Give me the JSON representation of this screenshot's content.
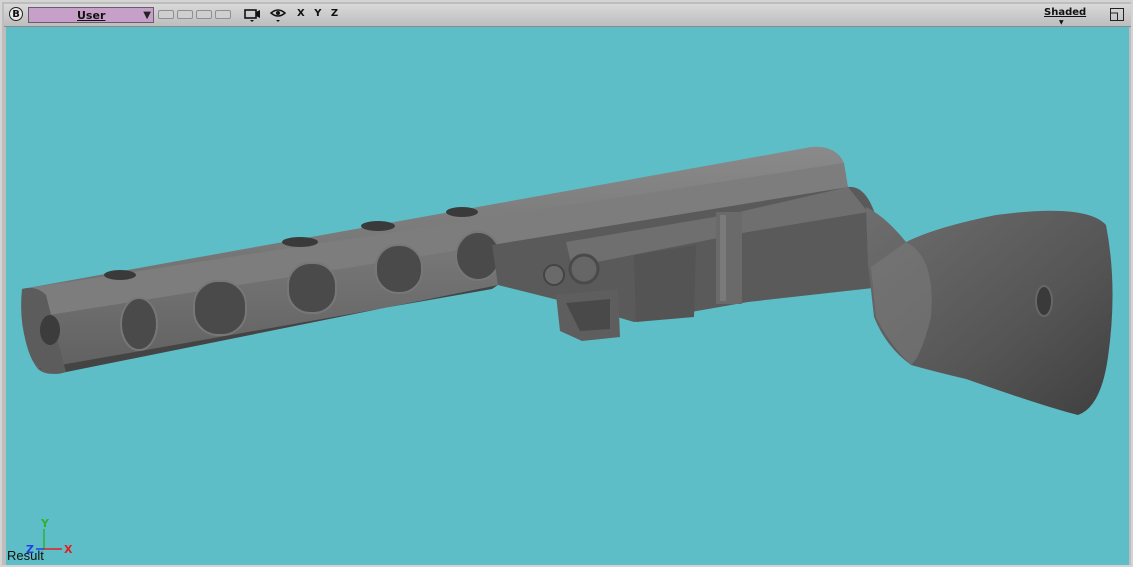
{
  "toolbar": {
    "b_button": "B",
    "camera_select": "User",
    "axes_label": "X Y Z",
    "shading_label": "Shaded",
    "icons": [
      "camera-icon",
      "eye-icon",
      "maximize-icon"
    ]
  },
  "viewport": {
    "background_color": "#5ebec7",
    "model_color": "#5b5b5b",
    "status_label": "Result",
    "axis_gizmo": {
      "y_label": "Y",
      "z_label": "Z",
      "x_label": "X"
    }
  }
}
